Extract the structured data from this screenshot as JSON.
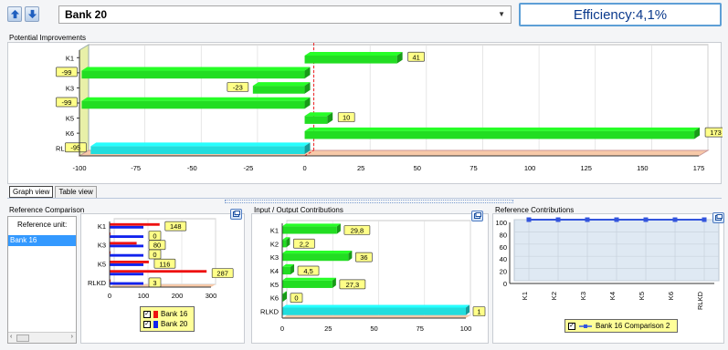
{
  "toolbar": {
    "up_icon": "arrow-up-icon",
    "down_icon": "arrow-down-icon",
    "unit_value": "Bank 20",
    "efficiency": "Efficiency:4,1%"
  },
  "potential": {
    "title": "Potential Improvements",
    "chart_data": {
      "type": "bar",
      "orientation": "horizontal",
      "categories": [
        "K1",
        "K2",
        "K3",
        "K4",
        "K5",
        "K6",
        "RLKD"
      ],
      "values": [
        41,
        -99,
        -23,
        -99,
        10,
        173,
        -95
      ],
      "labels": [
        "41",
        "-99",
        "-23",
        "-99",
        "10",
        "173",
        "-95"
      ],
      "colors": [
        "#22dd22",
        "#22dd22",
        "#22dd22",
        "#22dd22",
        "#22dd22",
        "#22dd22",
        "#22dddd"
      ],
      "xlim": [
        -100,
        175
      ],
      "xticks": [
        "-100",
        "-75",
        "-50",
        "-25",
        "0",
        "25",
        "50",
        "75",
        "100",
        "125",
        "150",
        "175"
      ],
      "grid": true
    }
  },
  "tabs": {
    "graph": "Graph view",
    "table": "Table view"
  },
  "reference": {
    "title": "Reference Comparison",
    "unit_label": "Reference unit:",
    "units": [
      "Bank 16"
    ],
    "chart_data": {
      "type": "bar",
      "orientation": "horizontal",
      "categories": [
        "K1",
        "K2",
        "K3",
        "K4",
        "K5",
        "K6",
        "RLKD"
      ],
      "category_labels_shown": [
        "K1",
        "K3",
        "K5",
        "RLKD"
      ],
      "series": [
        {
          "name": "Bank 16",
          "color": "#ee1111",
          "values": [
            148,
            0,
            80,
            0,
            116,
            287,
            3
          ]
        },
        {
          "name": "Bank 20",
          "color": "#1122ee",
          "values": [
            100,
            100,
            100,
            100,
            100,
            100,
            100
          ]
        }
      ],
      "labels": [
        "148",
        "0",
        "80",
        "0",
        "116",
        "287",
        "3"
      ],
      "xlim": [
        0,
        300
      ],
      "xticks": [
        "0",
        "100",
        "200",
        "300"
      ]
    }
  },
  "io": {
    "title": "Input / Output Contributions",
    "chart_data": {
      "type": "bar",
      "orientation": "horizontal",
      "categories": [
        "K1",
        "K2",
        "K3",
        "K4",
        "K5",
        "K6",
        "RLKD"
      ],
      "values": [
        29.8,
        2.2,
        36,
        4.5,
        27.3,
        0,
        100
      ],
      "labels": [
        "29,8",
        "2,2",
        "36",
        "4,5",
        "27,3",
        "0",
        "1"
      ],
      "colors": [
        "#22dd22",
        "#22dd22",
        "#22dd22",
        "#22dd22",
        "#22dd22",
        "#22dd22",
        "#22dddd"
      ],
      "xlim": [
        0,
        100
      ],
      "xticks": [
        "0",
        "25",
        "50",
        "75",
        "100"
      ]
    }
  },
  "refcontrib": {
    "title": "Reference Contributions",
    "chart_data": {
      "type": "line",
      "categories": [
        "K1",
        "K2",
        "K3",
        "K4",
        "K5",
        "K6",
        "RLKD"
      ],
      "series": [
        {
          "name": "Bank 16 Comparison 2",
          "color": "#3355dd",
          "values": [
            100,
            100,
            100,
            100,
            100,
            100,
            100
          ]
        }
      ],
      "ylim": [
        0,
        100
      ],
      "yticks": [
        "0",
        "20",
        "40",
        "60",
        "80",
        "100"
      ]
    }
  },
  "colors": {
    "accent": "#5d9fd6",
    "zero_line": "#ee2222",
    "floor": "#f7c9a8"
  }
}
